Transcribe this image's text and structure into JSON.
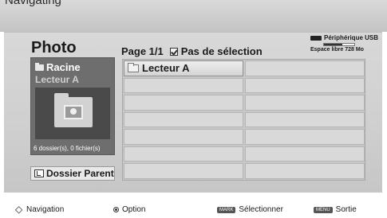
{
  "top_bar": {
    "text": "Navigating"
  },
  "panel": {
    "title": "Photo",
    "page_text": "Page 1/1",
    "selection_text": "Pas de sélection",
    "usb": {
      "device": "Périphérique USB",
      "free_space": "Espace libre 728 Mo",
      "icon": "usb-drive-icon",
      "usage_fraction": 0.6
    },
    "folder": {
      "root_label": "Racine",
      "device_label": "Lecteur A",
      "icon": "folder-photo-icon",
      "count_text": "6 dossier(s), 0 fichier(s)"
    },
    "parent_button": {
      "label": "Dossier Parent",
      "icon": "folder-up-icon"
    },
    "grid": {
      "rows": [
        [
          "Lecteur A",
          ""
        ],
        [
          "",
          ""
        ],
        [
          "",
          ""
        ],
        [
          "",
          ""
        ],
        [
          "",
          ""
        ],
        [
          "",
          ""
        ],
        [
          "",
          ""
        ]
      ]
    }
  },
  "bottom_bar": {
    "navigation": "Navigation",
    "option": "Option",
    "mark_key": "MARK",
    "select": "Sélectionner",
    "menu_key": "MENU",
    "exit": "Sortie"
  },
  "colors": {
    "panel_bg": "#d0d0d0",
    "folder_box_bg": "#6e6e6e",
    "text": "#1a1a1a"
  }
}
